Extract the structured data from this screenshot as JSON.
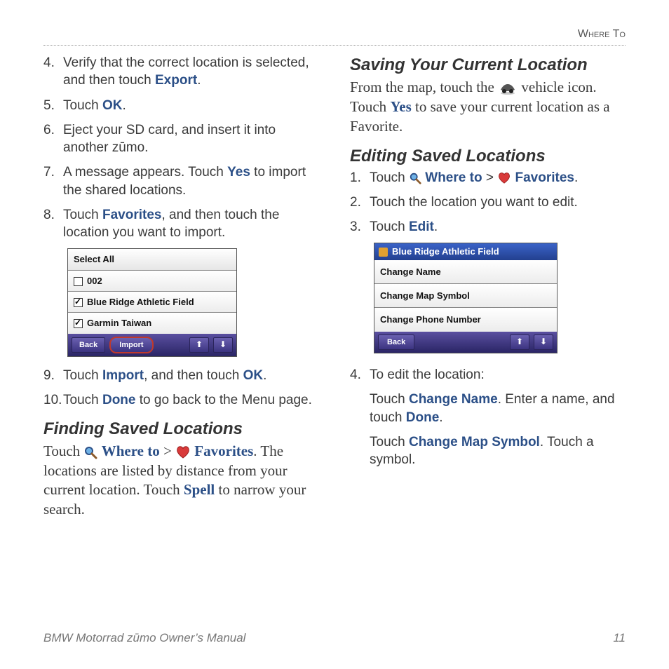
{
  "header": "Where To",
  "left": {
    "items": [
      {
        "n": "4.",
        "pre": "Verify that the correct location is selected, and then touch ",
        "kw": "Export",
        "post": "."
      },
      {
        "n": "5.",
        "pre": "Touch ",
        "kw": "OK",
        "post": "."
      },
      {
        "n": "6.",
        "pre": "Eject your SD card, and insert it into another zūmo.",
        "kw": "",
        "post": ""
      },
      {
        "n": "7.",
        "pre": "A message appears. Touch ",
        "kw": "Yes",
        "post": " to import the shared locations."
      },
      {
        "n": "8.",
        "pre": "Touch ",
        "kw": "Favorites",
        "post": ", and then touch the location you want to import."
      }
    ],
    "ui": {
      "select_all": "Select All",
      "r1": "002",
      "r2": "Blue Ridge Athletic Field",
      "r3": "Garmin Taiwan",
      "back": "Back",
      "import": "Import",
      "up": "⬆",
      "down": "⬇"
    },
    "items2": [
      {
        "n": "9.",
        "pre": "Touch ",
        "kw": "Import",
        "mid": ", and then touch ",
        "kw2": "OK",
        "post": "."
      },
      {
        "n": "10.",
        "pre": "Touch ",
        "kw": "Done",
        "post": " to go back to the Menu page."
      }
    ],
    "h2": "Finding Saved Locations",
    "find": {
      "t1": "Touch ",
      "where": "Where to",
      "gt": " > ",
      "fav": "Favorites",
      "t2": ". The locations are listed by distance from your current location. Touch ",
      "spell": "Spell",
      "t3": " to narrow your search."
    }
  },
  "right": {
    "h1": "Saving Your Current Location",
    "save": {
      "t1": "From the map, touch the ",
      "t2": " vehicle icon. Touch ",
      "yes": "Yes",
      "t3": " to save your current location as a Favorite."
    },
    "h2": "Editing Saved Locations",
    "steps": [
      {
        "n": "1.",
        "pre": "Touch ",
        "where": "Where to",
        "gt": " > ",
        "fav": "Favorites",
        "post": "."
      },
      {
        "n": "2.",
        "pre": "Touch the location you want to edit.",
        "post": ""
      },
      {
        "n": "3.",
        "pre": "Touch ",
        "kw": "Edit",
        "post": "."
      }
    ],
    "ui": {
      "title": "Blue Ridge Athletic Field",
      "o1": "Change Name",
      "o2": "Change Map Symbol",
      "o3": "Change Phone Number",
      "back": "Back",
      "up": "⬆",
      "down": "⬇"
    },
    "step4": {
      "n": "4.",
      "txt": "To edit the location:"
    },
    "p1": {
      "a": "Touch ",
      "kw": "Change Name",
      "b": ". Enter a name, and touch ",
      "kw2": "Done",
      "c": "."
    },
    "p2": {
      "a": "Touch ",
      "kw": "Change Map Symbol",
      "b": ". Touch a symbol."
    }
  },
  "footer": {
    "left": "BMW Motorrad zūmo Owner’s Manual",
    "right": "11"
  }
}
